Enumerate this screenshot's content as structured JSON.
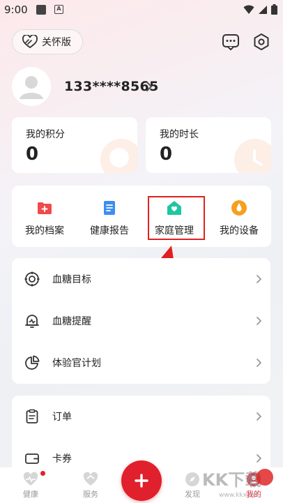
{
  "status_bar": {
    "time": "9:00",
    "a_glyph": "A"
  },
  "header": {
    "care_mode_label": "关怀版"
  },
  "profile": {
    "phone": "133****8565"
  },
  "stats": [
    {
      "label": "我的积分",
      "value": "0"
    },
    {
      "label": "我的时长",
      "value": "0"
    }
  ],
  "quick_actions": [
    {
      "label": "我的档案",
      "icon": "archive-icon",
      "color": "#f04a4a"
    },
    {
      "label": "健康报告",
      "icon": "report-icon",
      "color": "#3d8ef0"
    },
    {
      "label": "家庭管理",
      "icon": "family-icon",
      "color": "#1ec6a2"
    },
    {
      "label": "我的设备",
      "icon": "device-icon",
      "color": "#f5a020"
    }
  ],
  "menu_group_1": [
    {
      "label": "血糖目标",
      "icon": "target-icon"
    },
    {
      "label": "血糖提醒",
      "icon": "bell-icon"
    },
    {
      "label": "体验官计划",
      "icon": "pie-chart-icon"
    }
  ],
  "menu_group_2": [
    {
      "label": "订单",
      "icon": "order-icon"
    },
    {
      "label": "卡券",
      "icon": "wallet-icon"
    }
  ],
  "tabbar": {
    "tabs": [
      {
        "label": "健康"
      },
      {
        "label": "服务"
      },
      {
        "label": "发现"
      },
      {
        "label": "我的"
      }
    ],
    "plus_label": "+"
  },
  "colors": {
    "accent": "#e0202c",
    "highlight_box": "#e02020"
  },
  "watermark": {
    "text": "KK下载",
    "url_text": "www.kkx.net"
  }
}
